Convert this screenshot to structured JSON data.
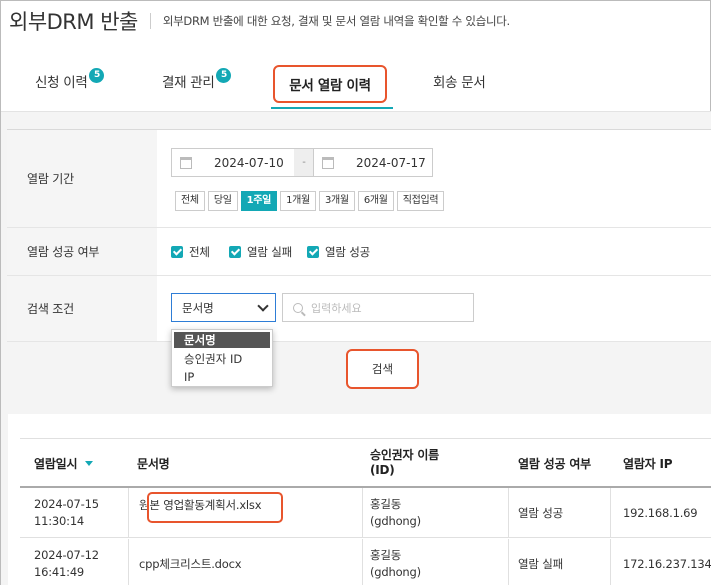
{
  "header": {
    "title": "외부DRM 반출",
    "description": "외부DRM 반출에 대한 요청, 결재 및 문서 열람 내역을 확인할 수 있습니다."
  },
  "tabs": [
    {
      "label": "신청 이력",
      "badge": "5"
    },
    {
      "label": "결재 관리",
      "badge": "5"
    },
    {
      "label": "문서 열람 이력",
      "badge": ""
    },
    {
      "label": "회송 문서",
      "badge": ""
    }
  ],
  "filter": {
    "period_label": "열람 기간",
    "date_from": "2024-07-10",
    "date_sep": "-",
    "date_to": "2024-07-17",
    "period_buttons": [
      "전체",
      "당일",
      "1주일",
      "1개월",
      "3개월",
      "6개월",
      "직접입력"
    ],
    "success_label": "열람 성공 여부",
    "checkboxes": [
      "전체",
      "열람 실패",
      "열람 성공"
    ],
    "search_label": "검색 조건",
    "select_value": "문서명",
    "search_placeholder": "입력하세요",
    "dropdown_options": [
      "문서명",
      "승인권자 ID",
      "IP"
    ],
    "search_button": "검색"
  },
  "table": {
    "headers": [
      "열람일시",
      "문서명",
      "승인권자 이름\n(ID)",
      "열람 성공 여부",
      "열람자 IP"
    ],
    "rows": [
      {
        "date": "2024-07-15",
        "time": "11:30:14",
        "doc": "원본 영업활동계획서.xlsx",
        "name": "홍길동",
        "id": "(gdhong)",
        "status": "열람 성공",
        "ip": "192.168.1.69"
      },
      {
        "date": "2024-07-12",
        "time": "16:41:49",
        "doc": "cpp체크리스트.docx",
        "name": "홍길동",
        "id": "(gdhong)",
        "status": "열람 실패",
        "ip": "172.16.237.134"
      }
    ]
  },
  "colors": {
    "accent": "#13a8b5",
    "highlight": "#e8552d"
  }
}
